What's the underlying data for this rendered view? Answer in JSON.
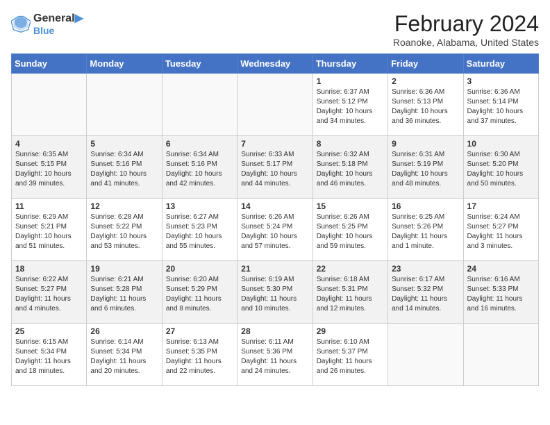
{
  "header": {
    "logo_line1": "General",
    "logo_line2": "Blue",
    "month_year": "February 2024",
    "location": "Roanoke, Alabama, United States"
  },
  "weekdays": [
    "Sunday",
    "Monday",
    "Tuesday",
    "Wednesday",
    "Thursday",
    "Friday",
    "Saturday"
  ],
  "weeks": [
    [
      {
        "day": "",
        "info": ""
      },
      {
        "day": "",
        "info": ""
      },
      {
        "day": "",
        "info": ""
      },
      {
        "day": "",
        "info": ""
      },
      {
        "day": "1",
        "info": "Sunrise: 6:37 AM\nSunset: 5:12 PM\nDaylight: 10 hours\nand 34 minutes."
      },
      {
        "day": "2",
        "info": "Sunrise: 6:36 AM\nSunset: 5:13 PM\nDaylight: 10 hours\nand 36 minutes."
      },
      {
        "day": "3",
        "info": "Sunrise: 6:36 AM\nSunset: 5:14 PM\nDaylight: 10 hours\nand 37 minutes."
      }
    ],
    [
      {
        "day": "4",
        "info": "Sunrise: 6:35 AM\nSunset: 5:15 PM\nDaylight: 10 hours\nand 39 minutes."
      },
      {
        "day": "5",
        "info": "Sunrise: 6:34 AM\nSunset: 5:16 PM\nDaylight: 10 hours\nand 41 minutes."
      },
      {
        "day": "6",
        "info": "Sunrise: 6:34 AM\nSunset: 5:16 PM\nDaylight: 10 hours\nand 42 minutes."
      },
      {
        "day": "7",
        "info": "Sunrise: 6:33 AM\nSunset: 5:17 PM\nDaylight: 10 hours\nand 44 minutes."
      },
      {
        "day": "8",
        "info": "Sunrise: 6:32 AM\nSunset: 5:18 PM\nDaylight: 10 hours\nand 46 minutes."
      },
      {
        "day": "9",
        "info": "Sunrise: 6:31 AM\nSunset: 5:19 PM\nDaylight: 10 hours\nand 48 minutes."
      },
      {
        "day": "10",
        "info": "Sunrise: 6:30 AM\nSunset: 5:20 PM\nDaylight: 10 hours\nand 50 minutes."
      }
    ],
    [
      {
        "day": "11",
        "info": "Sunrise: 6:29 AM\nSunset: 5:21 PM\nDaylight: 10 hours\nand 51 minutes."
      },
      {
        "day": "12",
        "info": "Sunrise: 6:28 AM\nSunset: 5:22 PM\nDaylight: 10 hours\nand 53 minutes."
      },
      {
        "day": "13",
        "info": "Sunrise: 6:27 AM\nSunset: 5:23 PM\nDaylight: 10 hours\nand 55 minutes."
      },
      {
        "day": "14",
        "info": "Sunrise: 6:26 AM\nSunset: 5:24 PM\nDaylight: 10 hours\nand 57 minutes."
      },
      {
        "day": "15",
        "info": "Sunrise: 6:26 AM\nSunset: 5:25 PM\nDaylight: 10 hours\nand 59 minutes."
      },
      {
        "day": "16",
        "info": "Sunrise: 6:25 AM\nSunset: 5:26 PM\nDaylight: 11 hours\nand 1 minute."
      },
      {
        "day": "17",
        "info": "Sunrise: 6:24 AM\nSunset: 5:27 PM\nDaylight: 11 hours\nand 3 minutes."
      }
    ],
    [
      {
        "day": "18",
        "info": "Sunrise: 6:22 AM\nSunset: 5:27 PM\nDaylight: 11 hours\nand 4 minutes."
      },
      {
        "day": "19",
        "info": "Sunrise: 6:21 AM\nSunset: 5:28 PM\nDaylight: 11 hours\nand 6 minutes."
      },
      {
        "day": "20",
        "info": "Sunrise: 6:20 AM\nSunset: 5:29 PM\nDaylight: 11 hours\nand 8 minutes."
      },
      {
        "day": "21",
        "info": "Sunrise: 6:19 AM\nSunset: 5:30 PM\nDaylight: 11 hours\nand 10 minutes."
      },
      {
        "day": "22",
        "info": "Sunrise: 6:18 AM\nSunset: 5:31 PM\nDaylight: 11 hours\nand 12 minutes."
      },
      {
        "day": "23",
        "info": "Sunrise: 6:17 AM\nSunset: 5:32 PM\nDaylight: 11 hours\nand 14 minutes."
      },
      {
        "day": "24",
        "info": "Sunrise: 6:16 AM\nSunset: 5:33 PM\nDaylight: 11 hours\nand 16 minutes."
      }
    ],
    [
      {
        "day": "25",
        "info": "Sunrise: 6:15 AM\nSunset: 5:34 PM\nDaylight: 11 hours\nand 18 minutes."
      },
      {
        "day": "26",
        "info": "Sunrise: 6:14 AM\nSunset: 5:34 PM\nDaylight: 11 hours\nand 20 minutes."
      },
      {
        "day": "27",
        "info": "Sunrise: 6:13 AM\nSunset: 5:35 PM\nDaylight: 11 hours\nand 22 minutes."
      },
      {
        "day": "28",
        "info": "Sunrise: 6:11 AM\nSunset: 5:36 PM\nDaylight: 11 hours\nand 24 minutes."
      },
      {
        "day": "29",
        "info": "Sunrise: 6:10 AM\nSunset: 5:37 PM\nDaylight: 11 hours\nand 26 minutes."
      },
      {
        "day": "",
        "info": ""
      },
      {
        "day": "",
        "info": ""
      }
    ]
  ]
}
